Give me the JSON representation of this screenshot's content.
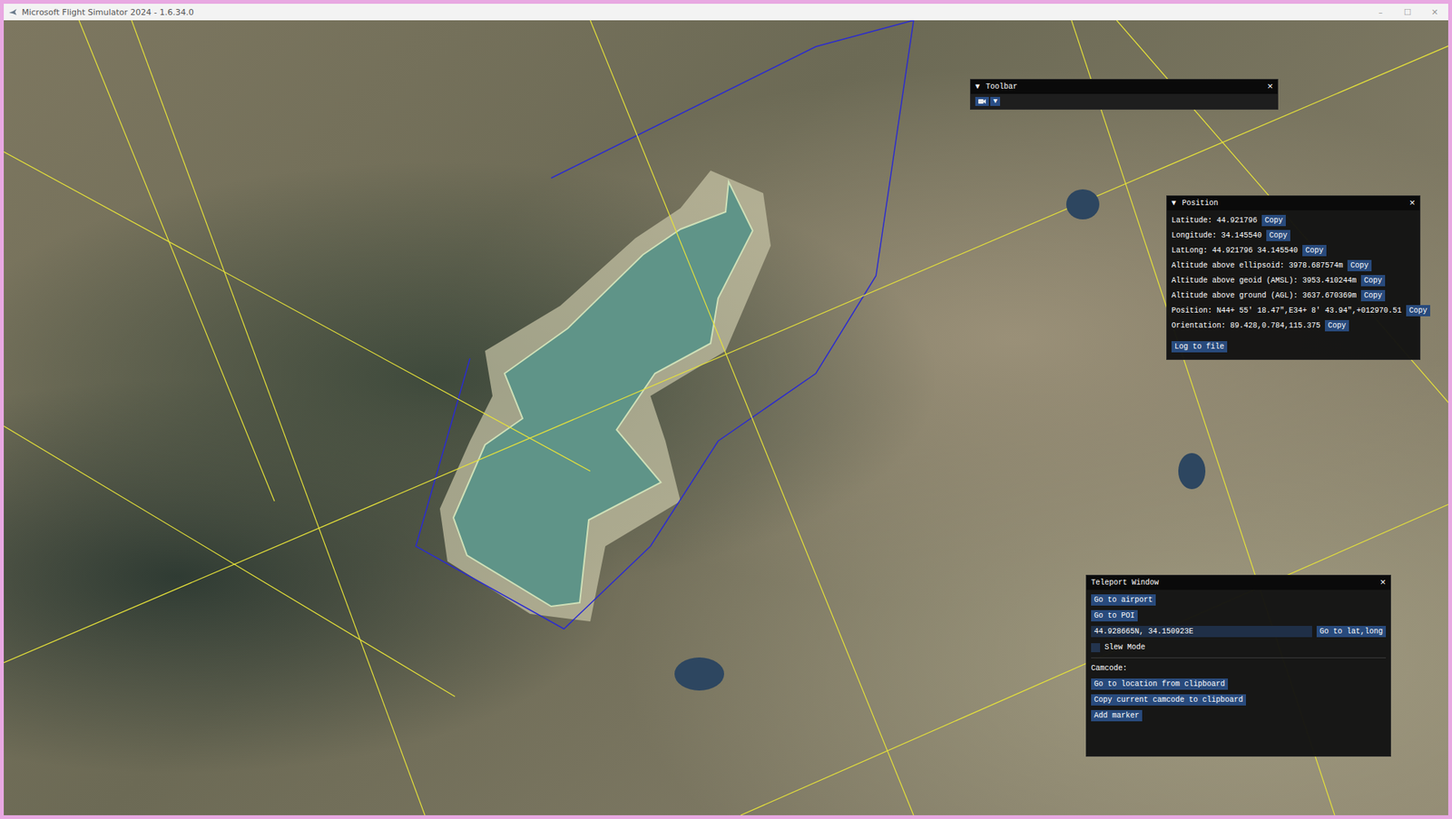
{
  "window": {
    "title": "Microsoft Flight Simulator 2024 - 1.6.34.0",
    "controls": [
      "–",
      "☐",
      "✕"
    ]
  },
  "toolbar": {
    "title": "Toolbar",
    "collapse": "▼",
    "close": "×",
    "menu_arrow": "▼"
  },
  "position": {
    "title": "Position",
    "collapse": "▼",
    "close": "×",
    "rows": [
      {
        "text": "Latitude: 44.921796",
        "button": "Copy"
      },
      {
        "text": "Longitude: 34.145540",
        "button": "Copy"
      },
      {
        "text": "LatLong: 44.921796 34.145540",
        "button": "Copy"
      },
      {
        "text": "Altitude above ellipsoid: 3978.687574m",
        "button": "Copy"
      },
      {
        "text": "Altitude above geoid (AMSL): 3953.410244m",
        "button": "Copy"
      },
      {
        "text": "Altitude above ground (AGL): 3637.670369m",
        "button": "Copy"
      },
      {
        "text": "Position: N44+ 55' 18.47\",E34+ 8' 43.94\",+012970.51",
        "button": "Copy"
      },
      {
        "text": "Orientation: 89.428,0.784,115.375",
        "button": "Copy"
      }
    ],
    "log_button": "Log to file"
  },
  "teleport": {
    "title": "Teleport Window",
    "close": "×",
    "top_buttons": [
      "Go to airport",
      "Go to POI"
    ],
    "coords_value": "44.928665N, 34.150923E",
    "go_button": "Go to lat,long",
    "slew": {
      "label": "Slew Mode",
      "checked": false
    },
    "camcode_label": "Camcode:",
    "camcode_buttons": [
      "Go to location from clipboard",
      "Copy current camcode to clipboard",
      "Add marker"
    ]
  }
}
